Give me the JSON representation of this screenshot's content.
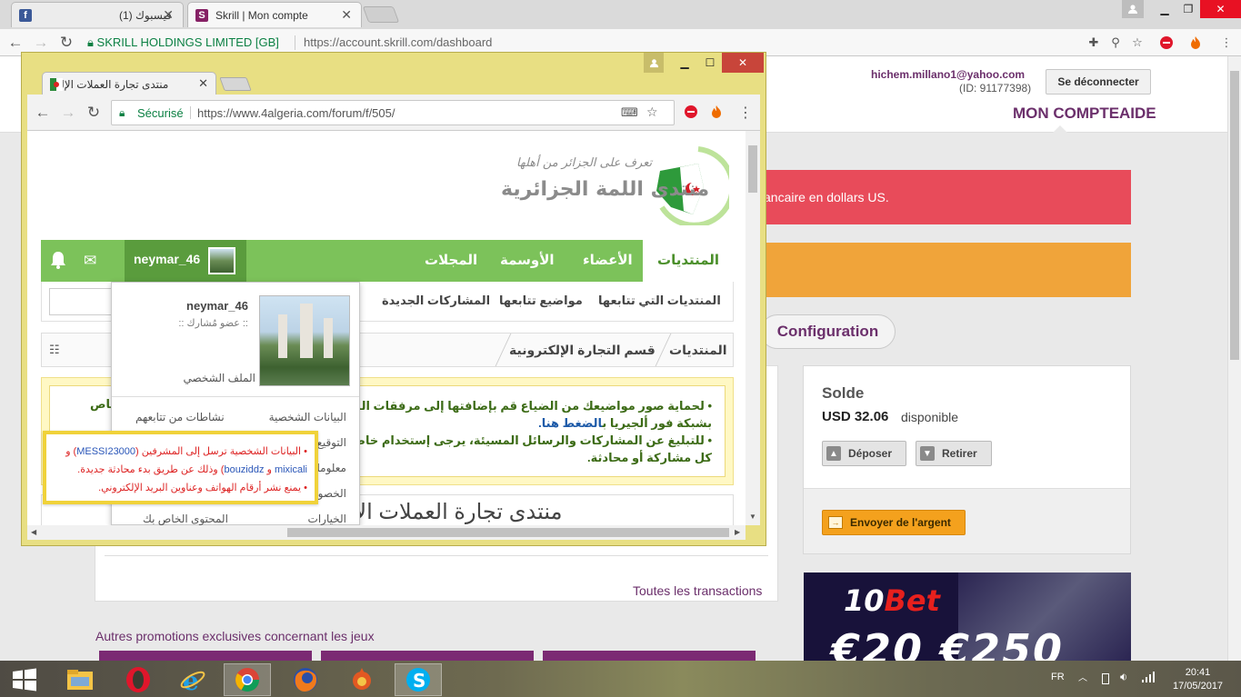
{
  "browser": {
    "tabs": [
      {
        "title": "(1) فيسبوك",
        "favicon": "facebook-icon"
      },
      {
        "title": "Skrill | Mon compte",
        "favicon": "skrill-icon"
      }
    ],
    "secure_label": "SKRILL HOLDINGS LIMITED [GB]",
    "url": "https://account.skrill.com/dashboard"
  },
  "skrill": {
    "email": "hichem.millano1@yahoo.com",
    "user_id": "(ID: 91177398)",
    "logout": "Se déconnecter",
    "nav": {
      "account": "MON COMPTE",
      "help": "AIDE"
    },
    "alert_red": "ancaire en dollars US.",
    "config": "Configuration",
    "balance": {
      "title": "Solde",
      "amount": "USD 32.06",
      "status": "disponible",
      "deposit": "Déposer",
      "withdraw": "Retirer",
      "send": "Envoyer de l'argent"
    },
    "all_transactions": "Toutes les transactions",
    "promos_title": "Autres promotions exclusives concernant les jeux",
    "ad": {
      "brand_num": "10",
      "brand": "Bet",
      "amounts": "€20 €250"
    },
    "colors": {
      "purple": "#6b2f6b",
      "alert_red": "#e84b5a",
      "alert_orange": "#f0a43a",
      "send": "#f4a11d"
    }
  },
  "forum_window": {
    "tab_title": "منتدى تجارة العملات الإلك",
    "secure_label": "Sécurisé",
    "url": "https://www.4algeria.com/forum/f/505/",
    "logo_text": "منتدى اللمة الجزائرية",
    "logo_sub": "تعرف على الجزائر من أهلها",
    "nav": {
      "forums": "المنتديات",
      "members": "الأعضاء",
      "badges": "الأوسمة",
      "magazines": "المجلات"
    },
    "username": "neymar_46",
    "subnav": {
      "followed_forums": "المنتديات التي تتابعها",
      "followed_topics": "مواضيع تتابعها",
      "new_posts": "المشاركات الجديدة"
    },
    "breadcrumb": {
      "home": "المنتديات",
      "section": "قسم التجارة الإلكترونية"
    },
    "notice": {
      "line1": "• لحماية صور مواضيعك من الضياع قم بإضافتها إلى مرفقات المنتدى",
      "line1b": "بشبكة فور ألجيريا ب",
      "link": "الضغط هنا.",
      "line2": "• للتبليغ عن المشاركات والرسائل المسيئة، يرجى إستخدام خاصية التبليغ",
      "line2b": "كل مشاركة أو محادثة.",
      "fragment": "خاص"
    },
    "page_title": "منتدى تجارة العملات الالكترونية [ بيع و",
    "dropdown": {
      "name": "neymar_46",
      "role": ":: عضو مُشارك ::",
      "profile": "الملف الشخصي",
      "items": {
        "personal": "البيانات الشخصية",
        "activity": "نشاطات من تتابعهم",
        "signature": "التوقيع",
        "info": "معلومات",
        "privacy": "الخصوصية",
        "options": "الخيارات",
        "content": "المحتوى الخاص بك"
      }
    },
    "tooltip": {
      "l1a": "• البيانات الشخصية ترسل إلى المشرفين (",
      "u1": "MESSI23000",
      "l1b": ") و",
      "u2": "mixicali",
      "l2a": "و",
      "u3": "bouziddz",
      "l2b": ") وذلك عن طريق بدء محادثة جديدة.",
      "l3": "• يمنع نشر أرقام الهواتف وعناوين البريد الإلكتروني."
    }
  },
  "taskbar": {
    "lang": "FR",
    "time": "20:41",
    "date": "17/05/2017"
  }
}
